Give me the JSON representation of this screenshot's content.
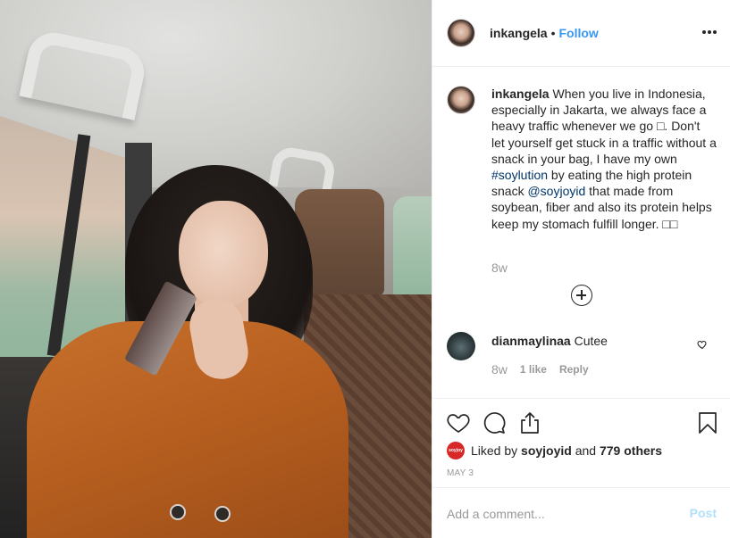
{
  "header": {
    "username": "inkangela",
    "separator": "•",
    "follow_label": "Follow"
  },
  "caption": {
    "username": "inkangela",
    "text_part1": " When you live in Indonesia, especially in Jakarta, we always face a heavy traffic whenever we go ",
    "emoji1": "□",
    "text_part2": ". Don't let yourself get stuck in a traffic without a snack in your bag, I have my own ",
    "hashtag": "#soylution",
    "text_part3": " by eating the high protein snack ",
    "mention": "@soyjoyid",
    "text_part4": " that made from soybean, fiber and also its protein helps keep my stomach fulfill longer. ",
    "emoji2": "□□",
    "time": "8w"
  },
  "comment": {
    "username": "dianmaylinaa",
    "text": " Cutee",
    "time": "8w",
    "likes": "1 like",
    "reply": "Reply"
  },
  "likes": {
    "badge_text": "soyjoy",
    "prefix": "Liked by ",
    "user": "soyjoyid",
    "middle": " and ",
    "others": "779 others"
  },
  "date": "MAY 3",
  "add_comment": {
    "placeholder": "Add a comment...",
    "post_label": "Post"
  },
  "icons": {
    "more": "more-options-icon",
    "like": "heart-icon",
    "comment": "comment-icon",
    "share": "share-icon",
    "save": "bookmark-icon",
    "load_more": "plus-circle-icon"
  },
  "colors": {
    "link": "#3897f0",
    "hashtag": "#003569",
    "muted": "#999999",
    "post_disabled": "#b2dffc"
  }
}
